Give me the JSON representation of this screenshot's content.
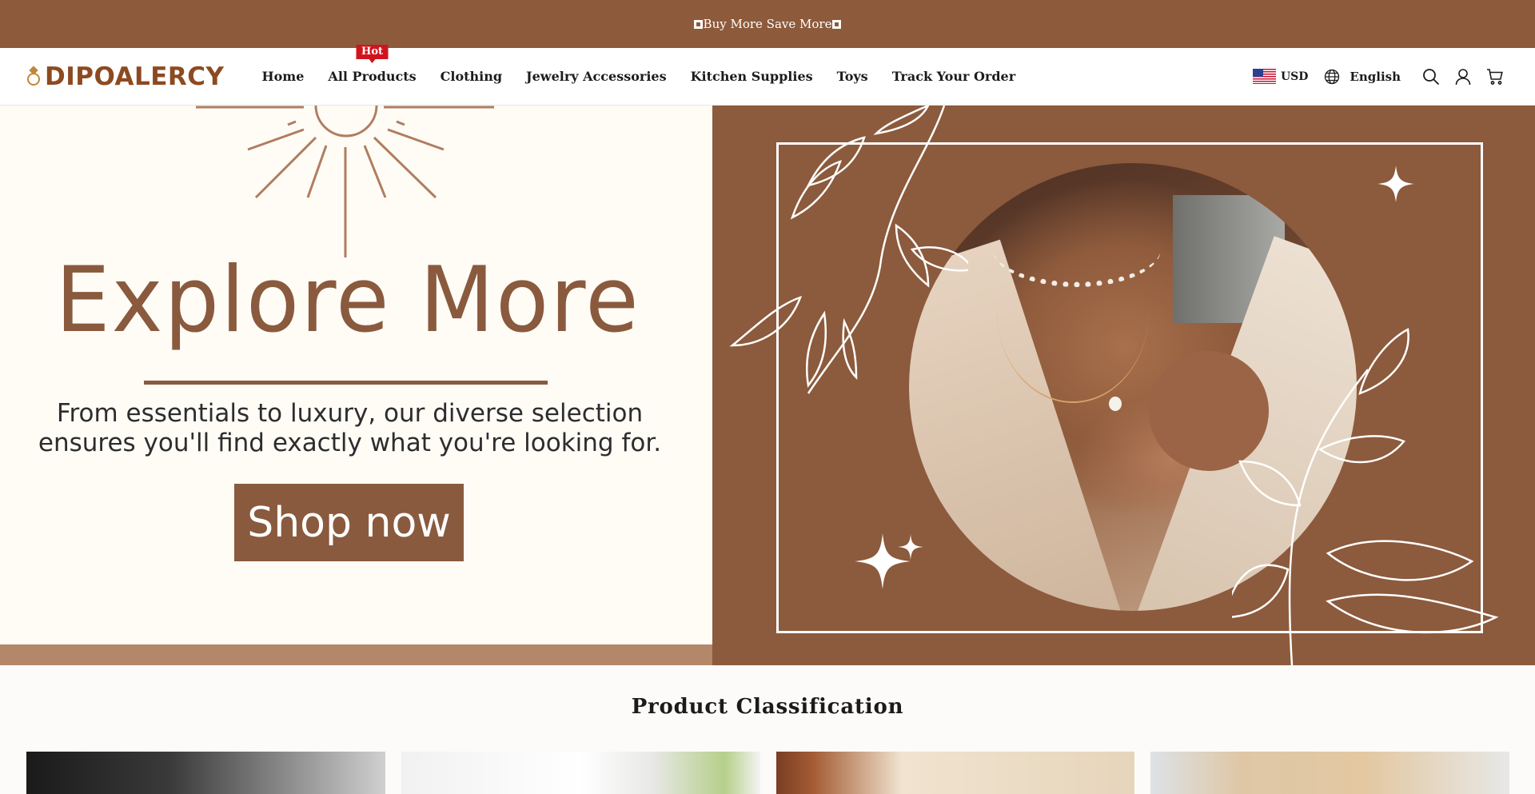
{
  "announcement": {
    "text": "Buy More Save More"
  },
  "header": {
    "logo_text": "DIPOALERCY",
    "nav": [
      {
        "label": "Home"
      },
      {
        "label": "All Products",
        "badge": "Hot"
      },
      {
        "label": "Clothing"
      },
      {
        "label": "Jewelry Accessories"
      },
      {
        "label": "Kitchen Supplies"
      },
      {
        "label": "Toys"
      },
      {
        "label": "Track Your Order"
      }
    ],
    "currency": "USD",
    "language": "English",
    "icons": [
      "flag-us-icon",
      "globe-icon",
      "search-icon",
      "account-icon",
      "cart-icon"
    ]
  },
  "hero": {
    "headline": "Explore More",
    "subline_1": "From essentials to luxury, our diverse selection",
    "subline_2": "ensures you'll find exactly what you're looking for.",
    "cta": "Shop now"
  },
  "section": {
    "title": "Product Classification"
  },
  "colors": {
    "brand_brown": "#8d5a3b",
    "logo_brown": "#8d4a20",
    "hero_cream": "#fffcf6",
    "hot_red": "#d0141d"
  }
}
